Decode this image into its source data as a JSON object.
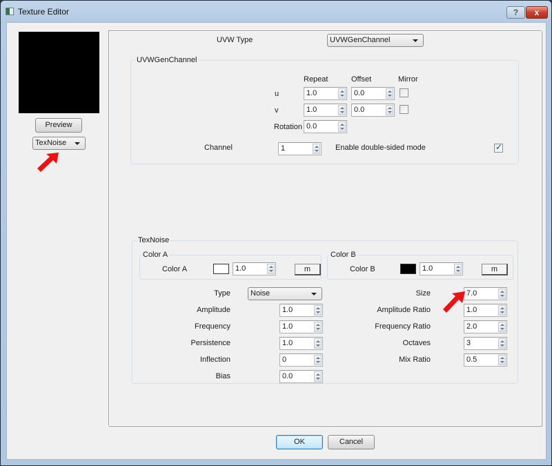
{
  "window": {
    "title": "Texture Editor",
    "help_button": "?",
    "close_button": "x"
  },
  "left_panel": {
    "preview_button": "Preview",
    "texture_type_select": "TexNoise"
  },
  "uvw": {
    "type_label": "UVW Type",
    "type_select": "UVWGenChannel",
    "group_title": "UVWGenChannel",
    "columns": {
      "repeat": "Repeat",
      "offset": "Offset",
      "mirror": "Mirror"
    },
    "rows": [
      {
        "label": "u",
        "repeat": "1.0",
        "offset": "0.0",
        "mirror": false
      },
      {
        "label": "v",
        "repeat": "1.0",
        "offset": "0.0",
        "mirror": false
      }
    ],
    "rotation_label": "Rotation",
    "rotation_value": "0.0",
    "channel_label": "Channel",
    "channel_value": "1",
    "double_sided_label": "Enable double-sided mode",
    "double_sided_checked": true
  },
  "texnoise": {
    "group_title": "TexNoise",
    "color_a": {
      "group_title": "Color A",
      "label": "Color A",
      "swatch_color": "#ffffff",
      "multiplier": "1.0",
      "map_button": "m"
    },
    "color_b": {
      "group_title": "Color B",
      "label": "Color B",
      "swatch_color": "#000000",
      "multiplier": "1.0",
      "map_button": "m"
    },
    "type_label": "Type",
    "type_select": "Noise",
    "left_params": [
      {
        "label": "Amplitude",
        "value": "1.0"
      },
      {
        "label": "Frequency",
        "value": "1.0"
      },
      {
        "label": "Persistence",
        "value": "1.0"
      },
      {
        "label": "Inflection",
        "value": "0"
      },
      {
        "label": "Bias",
        "value": "0.0"
      }
    ],
    "right_params": [
      {
        "label": "Size",
        "value": "7.0"
      },
      {
        "label": "Amplitude Ratio",
        "value": "1.0"
      },
      {
        "label": "Frequency Ratio",
        "value": "2.0"
      },
      {
        "label": "Octaves",
        "value": "3"
      },
      {
        "label": "Mix Ratio",
        "value": "0.5"
      }
    ]
  },
  "footer": {
    "ok_button": "OK",
    "cancel_button": "Cancel"
  },
  "annotations": {
    "arrow_color": "#ee1111"
  }
}
